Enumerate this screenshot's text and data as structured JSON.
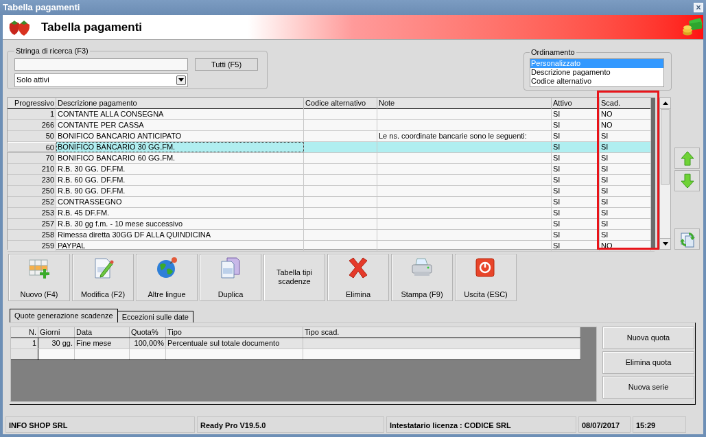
{
  "window": {
    "title": "Tabella pagamenti",
    "close": "×"
  },
  "header": {
    "title": "Tabella pagamenti"
  },
  "search": {
    "legend": "Stringa di ricerca (F3)",
    "button": "Tutti (F5)",
    "filter": "Solo attivi"
  },
  "ordering": {
    "legend": "Ordinamento",
    "options": [
      {
        "label": "Personalizzato",
        "selected": true
      },
      {
        "label": "Descrizione pagamento",
        "selected": false
      },
      {
        "label": "Codice alternativo",
        "selected": false
      }
    ]
  },
  "table": {
    "columns": [
      {
        "label": "Progressivo",
        "highlighted": false
      },
      {
        "label": "Descrizione pagamento",
        "highlighted": false
      },
      {
        "label": "Codice alternativo",
        "highlighted": false
      },
      {
        "label": "Note",
        "highlighted": false
      },
      {
        "label": "Attivo",
        "highlighted": false
      },
      {
        "label": "Scad.",
        "highlighted": true
      }
    ],
    "rows": [
      {
        "cells": [
          "1",
          "CONTANTE ALLA CONSEGNA",
          "",
          "",
          "SI",
          "NO"
        ],
        "selected": false
      },
      {
        "cells": [
          "266",
          "CONTANTE PER CASSA",
          "",
          "",
          "SI",
          "NO"
        ],
        "selected": false
      },
      {
        "cells": [
          "50",
          "BONIFICO BANCARIO ANTICIPATO",
          "",
          "Le ns. coordinate bancarie sono le seguenti:",
          "SI",
          "SI"
        ],
        "selected": false
      },
      {
        "cells": [
          "60",
          "BONIFICO BANCARIO 30 GG.FM.",
          "",
          "",
          "SI",
          "SI"
        ],
        "selected": true
      },
      {
        "cells": [
          "70",
          "BONIFICO BANCARIO 60 GG.FM.",
          "",
          "",
          "SI",
          "SI"
        ],
        "selected": false
      },
      {
        "cells": [
          "210",
          "R.B. 30 GG. DF.FM.",
          "",
          "",
          "SI",
          "SI"
        ],
        "selected": false
      },
      {
        "cells": [
          "230",
          "R.B. 60 GG. DF.FM.",
          "",
          "",
          "SI",
          "SI"
        ],
        "selected": false
      },
      {
        "cells": [
          "250",
          "R.B. 90 GG. DF.FM.",
          "",
          "",
          "SI",
          "SI"
        ],
        "selected": false
      },
      {
        "cells": [
          "252",
          "CONTRASSEGNO",
          "",
          "",
          "SI",
          "SI"
        ],
        "selected": false
      },
      {
        "cells": [
          "253",
          "R.B. 45 DF.FM.",
          "",
          "",
          "SI",
          "SI"
        ],
        "selected": false
      },
      {
        "cells": [
          "257",
          "R.B. 30 gg f.m. - 10 mese successivo",
          "",
          "",
          "SI",
          "SI"
        ],
        "selected": false
      },
      {
        "cells": [
          "258",
          "Rimessa diretta 30GG DF ALLA QUINDICINA",
          "",
          "",
          "SI",
          "SI"
        ],
        "selected": false
      },
      {
        "cells": [
          "259",
          "PAYPAL",
          "",
          "",
          "SI",
          "NO"
        ],
        "selected": false
      }
    ]
  },
  "toolbar": [
    {
      "kind": "new",
      "label": "Nuovo (F4)"
    },
    {
      "kind": "edit",
      "label": "Modifica (F2)"
    },
    {
      "kind": "globe",
      "label": "Altre lingue"
    },
    {
      "kind": "duplicate",
      "label": "Duplica"
    },
    {
      "kind": "text",
      "label": "Tabella tipi scadenze"
    },
    {
      "kind": "delete",
      "label": "Elimina"
    },
    {
      "kind": "print",
      "label": "Stampa (F9)"
    },
    {
      "kind": "exit",
      "label": "Uscita (ESC)"
    }
  ],
  "tabs": [
    {
      "label": "Quote generazione scadenze",
      "selected": true
    },
    {
      "label": "Eccezioni sulle date",
      "selected": false
    }
  ],
  "quotas": {
    "columns": [
      "N.",
      "Giorni",
      "Data",
      "Quota%",
      "Tipo",
      "Tipo scad."
    ],
    "rows": [
      [
        "1",
        "30 gg.",
        "Fine mese",
        "100,00%",
        "Percentuale sul totale documento",
        ""
      ]
    ]
  },
  "quota_buttons": [
    "Nuova quota",
    "Elimina quota",
    "Nuova serie"
  ],
  "status_bar": [
    "INFO SHOP SRL",
    "Ready Pro V19.5.0",
    "Intestatario licenza : CODICE SRL",
    "08/07/2017",
    "15:29"
  ]
}
